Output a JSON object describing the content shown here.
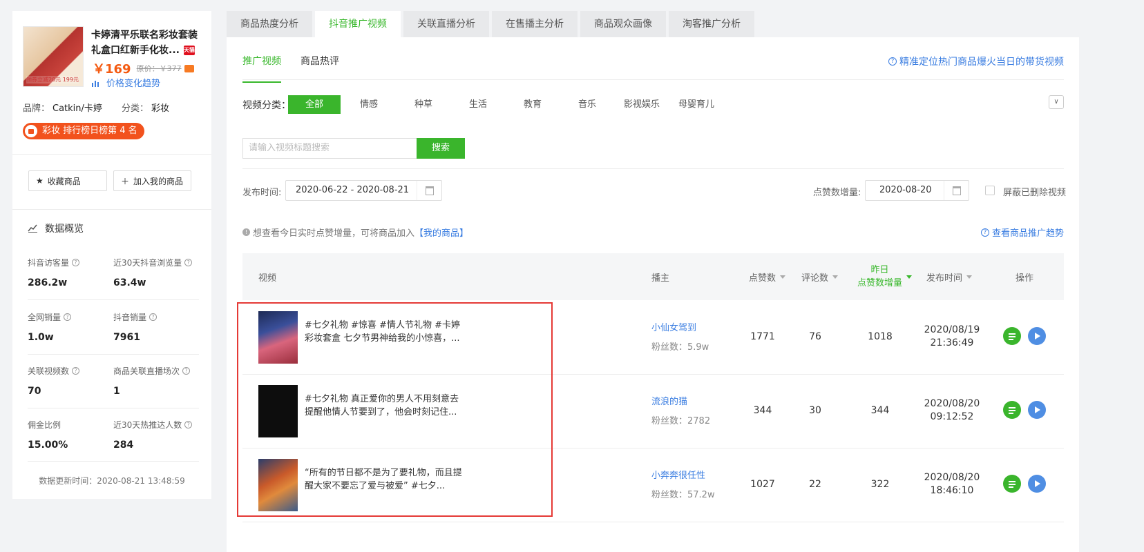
{
  "product": {
    "title": "卡婷清平乐联名彩妆套装礼盒口红新手化妆...",
    "store_badge": "天猫",
    "price": "￥169",
    "original_price": "原价：￥377",
    "trend_link": "价格变化趋势",
    "brand_label": "品牌：",
    "brand_value": "Catkin/卡婷",
    "category_label": "分类：",
    "category_value": "彩妆",
    "rank_badge": "彩妆 排行榜日榜第 4 名",
    "image_caption": "领券立减20元 199元"
  },
  "actions": {
    "favorite": "收藏商品",
    "add_mine": "加入我的商品"
  },
  "overview": {
    "title": "数据概览",
    "stats": [
      {
        "label": "抖音访客量",
        "value": "286.2w"
      },
      {
        "label": "近30天抖音浏览量",
        "value": "63.4w"
      },
      {
        "label": "全网销量",
        "value": "1.0w"
      },
      {
        "label": "抖音销量",
        "value": "7961"
      },
      {
        "label": "关联视频数",
        "value": "70"
      },
      {
        "label": "商品关联直播场次",
        "value": "1"
      },
      {
        "label": "佣金比例",
        "value": "15.00%"
      },
      {
        "label": "近30天热推达人数",
        "value": "284"
      }
    ],
    "update_time": "数据更新时间：2020-08-21 13:48:59"
  },
  "top_tabs": [
    "商品热度分析",
    "抖音推广视频",
    "关联直播分析",
    "在售播主分析",
    "商品观众画像",
    "淘客推广分析"
  ],
  "sub_tabs": [
    "推广视频",
    "商品热评"
  ],
  "top_hint": "精准定位热门商品爆火当日的带货视频",
  "category": {
    "label": "视频分类：",
    "items": [
      "全部",
      "情感",
      "种草",
      "生活",
      "教育",
      "音乐",
      "影视娱乐",
      "母婴育儿"
    ]
  },
  "search": {
    "placeholder": "请输入视频标题搜索",
    "button": "搜索"
  },
  "filters": {
    "publish_label": "发布时间:",
    "publish_range": "2020-06-22 - 2020-08-21",
    "likes_label": "点赞数增量:",
    "likes_date": "2020-08-20",
    "hide_deleted": "屏蔽已删除视频"
  },
  "info": {
    "text": "想查看今日实时点赞增量，可将商品加入",
    "link": "【我的商品】",
    "trend": "查看商品推广趋势"
  },
  "table": {
    "headers": {
      "video": "视频",
      "anchor": "播主",
      "likes": "点赞数",
      "comments": "评论数",
      "yesterday_1": "昨日",
      "yesterday_2": "点赞数增量",
      "publish": "发布时间",
      "ops": "操作"
    },
    "rows": [
      {
        "title": "#七夕礼物 #惊喜 #情人节礼物 #卡婷彩妆套盒 七夕节男神给我的小惊喜，...",
        "anchor": "小仙女驾到",
        "fans": "粉丝数：5.9w",
        "likes": "1771",
        "comments": "76",
        "delta": "1018",
        "date": "2020/08/19",
        "time": "21:36:49"
      },
      {
        "title": "#七夕礼物 真正爱你的男人不用刻意去提醒他情人节要到了，他会时刻记住...",
        "anchor": "流浪的猫",
        "fans": "粉丝数：2782",
        "likes": "344",
        "comments": "30",
        "delta": "344",
        "date": "2020/08/20",
        "time": "09:12:52"
      },
      {
        "title": "“所有的节日都不是为了要礼物，而且提醒大家不要忘了爱与被爱” #七夕...",
        "anchor": "小奔奔很任性",
        "fans": "粉丝数：57.2w",
        "likes": "1027",
        "comments": "22",
        "delta": "322",
        "date": "2020/08/20",
        "time": "18:46:10"
      }
    ]
  },
  "colors": {
    "green": "#3ab52c",
    "blue": "#3a7de1",
    "orange": "#f45b12",
    "highlight": "#e53935"
  }
}
